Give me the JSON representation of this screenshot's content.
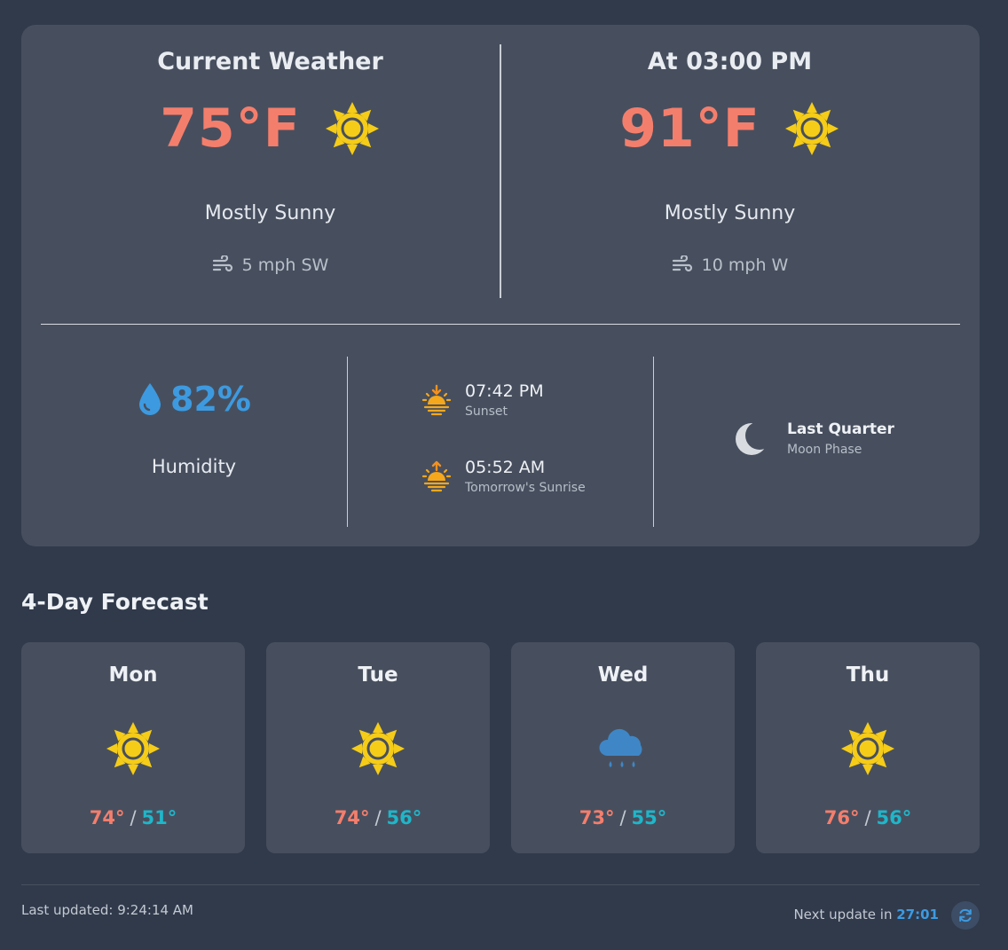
{
  "current": {
    "title": "Current Weather",
    "temp": "75°F",
    "condition": "Mostly Sunny",
    "wind": "5 mph SW",
    "icon": "sun-icon"
  },
  "later": {
    "title": "At 03:00 PM",
    "temp": "91°F",
    "condition": "Mostly Sunny",
    "wind": "10 mph W",
    "icon": "sun-icon"
  },
  "humidity": {
    "value": "82%",
    "label": "Humidity"
  },
  "sunset": {
    "time": "07:42 PM",
    "label": "Sunset"
  },
  "sunrise": {
    "time": "05:52 AM",
    "label": "Tomorrow's Sunrise"
  },
  "moon": {
    "phase": "Last Quarter",
    "label": "Moon Phase"
  },
  "forecast": {
    "title": "4-Day Forecast",
    "days": [
      {
        "day": "Mon",
        "high": "74°",
        "low": "51°",
        "icon": "sun-icon"
      },
      {
        "day": "Tue",
        "high": "74°",
        "low": "56°",
        "icon": "sun-icon"
      },
      {
        "day": "Wed",
        "high": "73°",
        "low": "55°",
        "icon": "rain-cloud-icon"
      },
      {
        "day": "Thu",
        "high": "76°",
        "low": "56°",
        "icon": "sun-icon"
      }
    ]
  },
  "footer": {
    "last_updated": "Last updated: 9:24:14 AM",
    "next_update_prefix": "Next update in",
    "countdown": "27:01"
  },
  "colors": {
    "background": "#303a4b",
    "card": "#474f5e",
    "temp_high": "#f47e6c",
    "temp_low": "#1fb6c9",
    "accent_blue": "#3d9ae0",
    "sun_yellow": "#f5cc18"
  }
}
